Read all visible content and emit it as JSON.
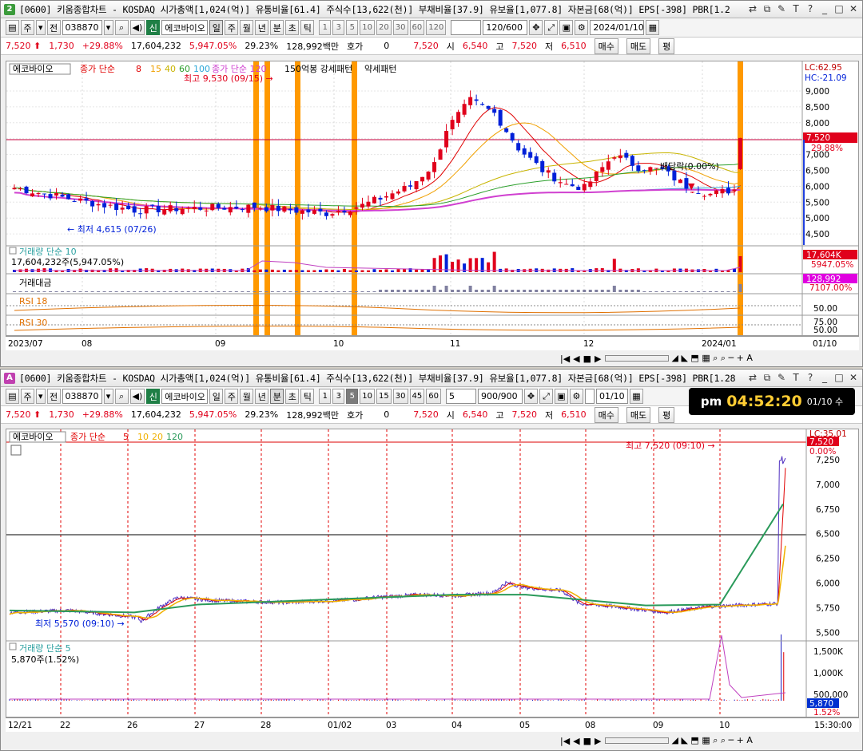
{
  "colors": {
    "up": "#e0001b",
    "down": "#0020d8",
    "accent_orange": "#ff9900"
  },
  "top": {
    "title_badge": "2",
    "title": "[0600] 키움종합차트 - KOSDAQ 시가총액[1,024(억)] 유통비율[61.4] 주식수[13,622(천)] 부채비율[37.9] 유보율[1,077.8] 자본금[68(억)] EPS[-398] PBR[1.2",
    "toolbar": {
      "code": "038870",
      "name": "에코바이오",
      "tag_new": "신",
      "type_label": "주",
      "period_label": "전",
      "day": "일",
      "week": "주",
      "month": "월",
      "year": "년",
      "minute": "분",
      "tick_sec": "초",
      "tick": "틱",
      "intervals": [
        "1",
        "3",
        "5",
        "10",
        "20",
        "30",
        "60",
        "120"
      ],
      "count": "120/600",
      "date": "2024/01/10"
    },
    "quote": {
      "price": "7,520",
      "arrow": "⬆",
      "change": "1,730",
      "pct": "+29.88%",
      "volume": "17,604,232",
      "vol_ratio": "5,947.05%",
      "turnover": "29.23%",
      "amount": "128,992백만",
      "hoga_label": "호가",
      "hoga": "0",
      "cur": "7,520",
      "open_label": "시",
      "open": "6,540",
      "high_label": "고",
      "high": "7,520",
      "low_label": "저",
      "low": "6,510",
      "buy": "매수",
      "sell": "매도",
      "eval": "평"
    },
    "legend": {
      "name": "에코바이오",
      "ma_label": "종가 단순",
      "ma_periods": [
        "8",
        "15",
        "40",
        "60",
        "100"
      ],
      "extra1": "종가 단순 120",
      "extra2": "150억봉 강세패턴",
      "extra3": "약세패턴"
    },
    "annotations": {
      "high": "최고 9,530 (09/15)",
      "low": "최저 4,615 (07/26)",
      "div": "배당락(0.00%)"
    },
    "right_axis": {
      "lc": "LC:62.95",
      "hc": "HC:-21.09",
      "ticks": [
        "9,000",
        "8,500",
        "8,000",
        "7,500",
        "7,000",
        "6,500",
        "6,000",
        "5,500",
        "5,000",
        "4,500"
      ],
      "price_tag": "7,520",
      "pct_tag": "29.88%"
    },
    "volume": {
      "label": "거래량 단순 10",
      "value": "17,604,232주(5,947.05%)",
      "tag": "17,604K",
      "tag2": "5947.05%"
    },
    "amount": {
      "label": "거래대금",
      "tag": "128,992",
      "tag2": "7107.00%"
    },
    "rsi18": {
      "label": "RSI 18",
      "tick": "50.00"
    },
    "rsi30": {
      "label": "RSI 30",
      "tick": "75.00",
      "tick2": "50.00"
    },
    "xaxis": [
      "2023/07",
      "08",
      "09",
      "10",
      "11",
      "12",
      "2024/01"
    ],
    "xaxis_end": "01/10"
  },
  "bottom": {
    "title_badge": "A",
    "title": "[0600] 키움종합차트 - KOSDAQ 시가총액[1,024(억)] 유통비율[61.4] 주식수[13,622(천)] 부채비율[37.9] 유보율[1,077.8] 자본금[68(억)] EPS[-398] PBR[1.28",
    "toolbar": {
      "code": "038870",
      "name": "에코바이오",
      "tag_new": "신",
      "type_label": "주",
      "period_label": "전",
      "day": "일",
      "week": "주",
      "month": "월",
      "year": "년",
      "minute": "분",
      "tick_sec": "초",
      "tick": "틱",
      "intervals": [
        "1",
        "3",
        "5",
        "10",
        "15",
        "30",
        "45",
        "60"
      ],
      "interval_sel": "5",
      "count": "900/900",
      "date": "01/10"
    },
    "quote": {
      "price": "7,520",
      "arrow": "⬆",
      "change": "1,730",
      "pct": "+29.88%",
      "volume": "17,604,232",
      "vol_ratio": "5,947.05%",
      "turnover": "29.23%",
      "amount": "128,992백만",
      "hoga_label": "호가",
      "hoga": "0",
      "cur": "7,520",
      "open_label": "시",
      "open": "6,540",
      "high_label": "고",
      "high": "7,520",
      "low_label": "저",
      "low": "6,510",
      "buy": "매수",
      "sell": "매도",
      "eval": "평"
    },
    "clock": {
      "ampm": "pm",
      "time": "04:52:20",
      "date": "01/10 수"
    },
    "legend": {
      "name": "에코바이오",
      "ma_label": "종가 단순",
      "ma_periods": [
        "5",
        "10",
        "20",
        "120"
      ]
    },
    "annotations": {
      "high": "최고 7,520 (09:10)",
      "low": "최저 5,570 (09:10)"
    },
    "right_axis": {
      "lc": "LC:35.01",
      "ticks": [
        "7,250",
        "7,000",
        "6,750",
        "6,500",
        "6,250",
        "6,000",
        "5,750",
        "5,500"
      ],
      "price_tag": "7,520",
      "pct_tag": "0.00%"
    },
    "volume": {
      "label": "거래량 단순 5",
      "value": "5,870주(1.52%)",
      "ticks": [
        "1,500K",
        "1,000K",
        "500,000"
      ],
      "tag": "5,870",
      "tag2": "1.52%"
    },
    "xaxis": [
      "12/21",
      "22",
      "26",
      "27",
      "28",
      "01/02",
      "03",
      "04",
      "05",
      "08",
      "09",
      "10"
    ],
    "xaxis_end": "15:30:00"
  }
}
